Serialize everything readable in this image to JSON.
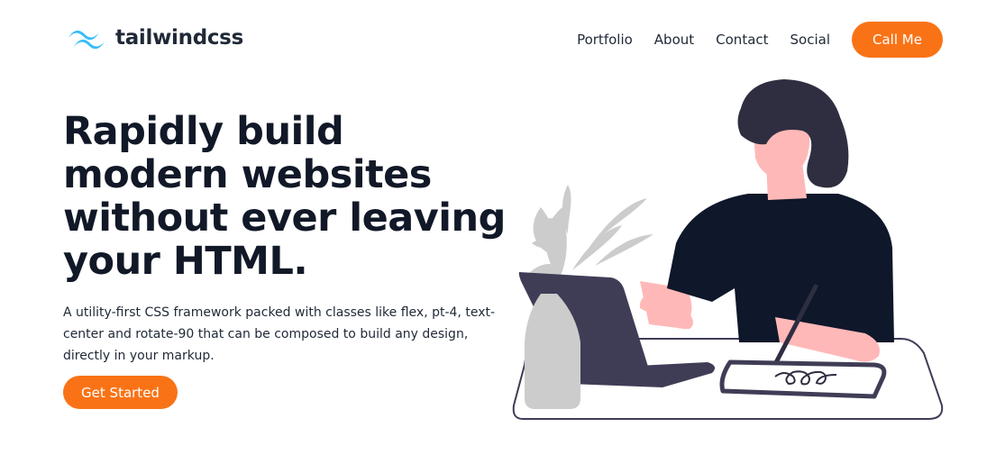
{
  "brand": {
    "name": "tailwindcss",
    "icon": "tailwind-wave-logo",
    "color": "#38bdf8"
  },
  "nav": {
    "links": [
      "Portfolio",
      "About",
      "Contact",
      "Social"
    ],
    "cta_label": "Call Me"
  },
  "hero": {
    "title_lines": [
      "Rapidly build",
      "modern websites",
      "without ever leaving",
      "your HTML."
    ],
    "description": "A utility-first CSS framework packed with classes like flex, pt-4, text-center and rotate-90 that can be composed to build any design, directly in your markup.",
    "cta_label": "Get Started"
  },
  "theme": {
    "accent": "#f97316",
    "text": "#111827",
    "illustration_dark": "#0f172a",
    "illustration_laptop": "#3f3d56",
    "illustration_skin": "#ffb8b8",
    "illustration_plant": "#cccccc"
  },
  "illustration": {
    "name": "woman-drawing-on-tablet-illustration"
  }
}
